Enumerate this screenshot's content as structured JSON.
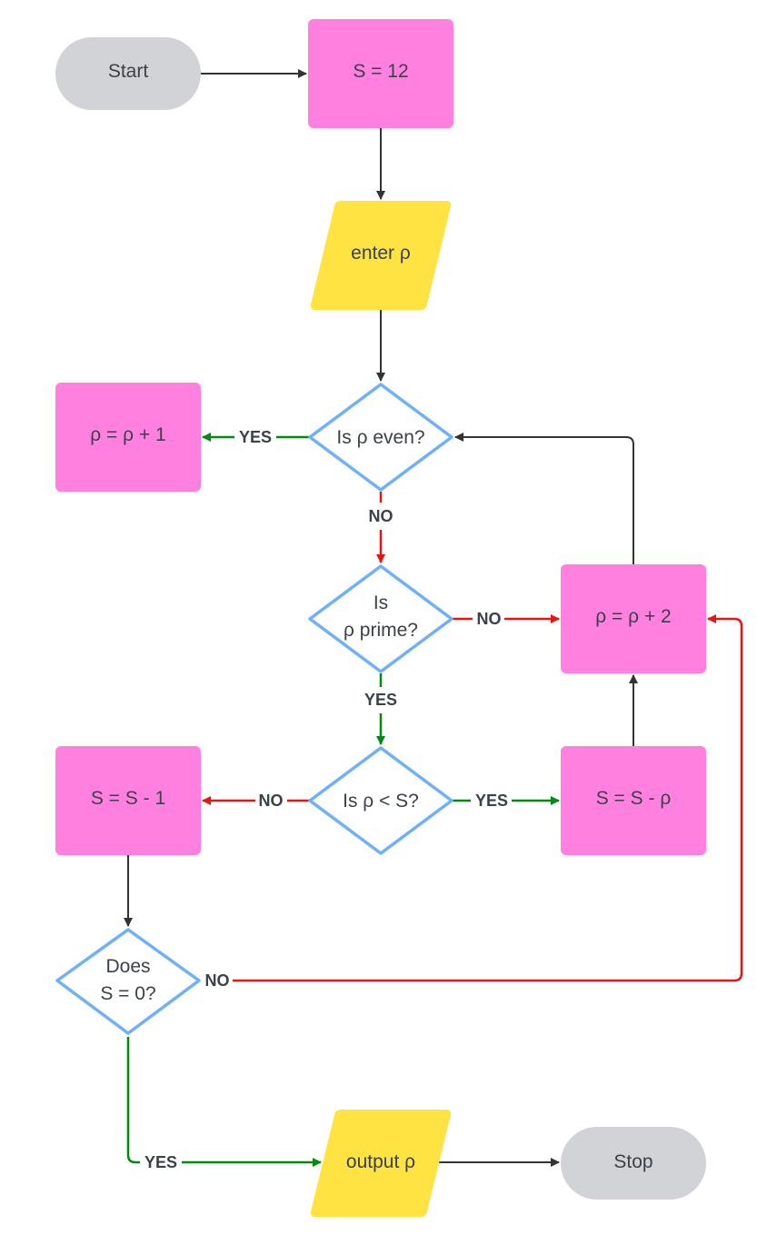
{
  "colors": {
    "terminal": "#d1d3d6",
    "process": "#ff80df",
    "io": "#ffe343",
    "decision_stroke": "#6fb0fa",
    "decision_fill": "#ffffff",
    "text": "#3a414a",
    "arrow_default": "#333333",
    "arrow_yes": "#008a0e",
    "arrow_no": "#e81313"
  },
  "nodes": {
    "start": {
      "label": "Start",
      "type": "terminal"
    },
    "init_s": {
      "label": "S = 12",
      "type": "process"
    },
    "enter_p": {
      "label": "enter ρ",
      "type": "io"
    },
    "is_even": {
      "lines": [
        "Is ρ even?"
      ],
      "type": "decision"
    },
    "p_plus_1": {
      "label": "ρ = ρ + 1",
      "type": "process"
    },
    "is_prime": {
      "lines": [
        "Is",
        "ρ prime?"
      ],
      "type": "decision"
    },
    "p_plus_2": {
      "label": "ρ = ρ + 2",
      "type": "process"
    },
    "is_less": {
      "lines": [
        "Is ρ < S?"
      ],
      "type": "decision"
    },
    "s_minus_1": {
      "label": "S = S - 1",
      "type": "process"
    },
    "s_minus_p": {
      "label": "S = S - ρ",
      "type": "process"
    },
    "s_zero": {
      "lines": [
        "Does",
        "S = 0?"
      ],
      "type": "decision"
    },
    "output_p": {
      "label": "output ρ",
      "type": "io"
    },
    "stop": {
      "label": "Stop",
      "type": "terminal"
    }
  },
  "edges": [
    {
      "from": "start",
      "to": "init_s",
      "label": "",
      "kind": "default"
    },
    {
      "from": "init_s",
      "to": "enter_p",
      "label": "",
      "kind": "default"
    },
    {
      "from": "enter_p",
      "to": "is_even",
      "label": "",
      "kind": "default"
    },
    {
      "from": "is_even",
      "to": "p_plus_1",
      "label": "YES",
      "kind": "yes"
    },
    {
      "from": "is_even",
      "to": "is_prime",
      "label": "NO",
      "kind": "no"
    },
    {
      "from": "is_prime",
      "to": "p_plus_2",
      "label": "NO",
      "kind": "no"
    },
    {
      "from": "is_prime",
      "to": "is_less",
      "label": "YES",
      "kind": "yes"
    },
    {
      "from": "p_plus_2",
      "to": "is_even",
      "label": "",
      "kind": "default"
    },
    {
      "from": "is_less",
      "to": "s_minus_1",
      "label": "NO",
      "kind": "no"
    },
    {
      "from": "is_less",
      "to": "s_minus_p",
      "label": "YES",
      "kind": "yes"
    },
    {
      "from": "s_minus_p",
      "to": "p_plus_2",
      "label": "",
      "kind": "default"
    },
    {
      "from": "s_minus_1",
      "to": "s_zero",
      "label": "",
      "kind": "default"
    },
    {
      "from": "s_zero",
      "to": "p_plus_2",
      "label": "NO",
      "kind": "no"
    },
    {
      "from": "s_zero",
      "to": "output_p",
      "label": "YES",
      "kind": "yes"
    },
    {
      "from": "output_p",
      "to": "stop",
      "label": "",
      "kind": "default"
    }
  ]
}
